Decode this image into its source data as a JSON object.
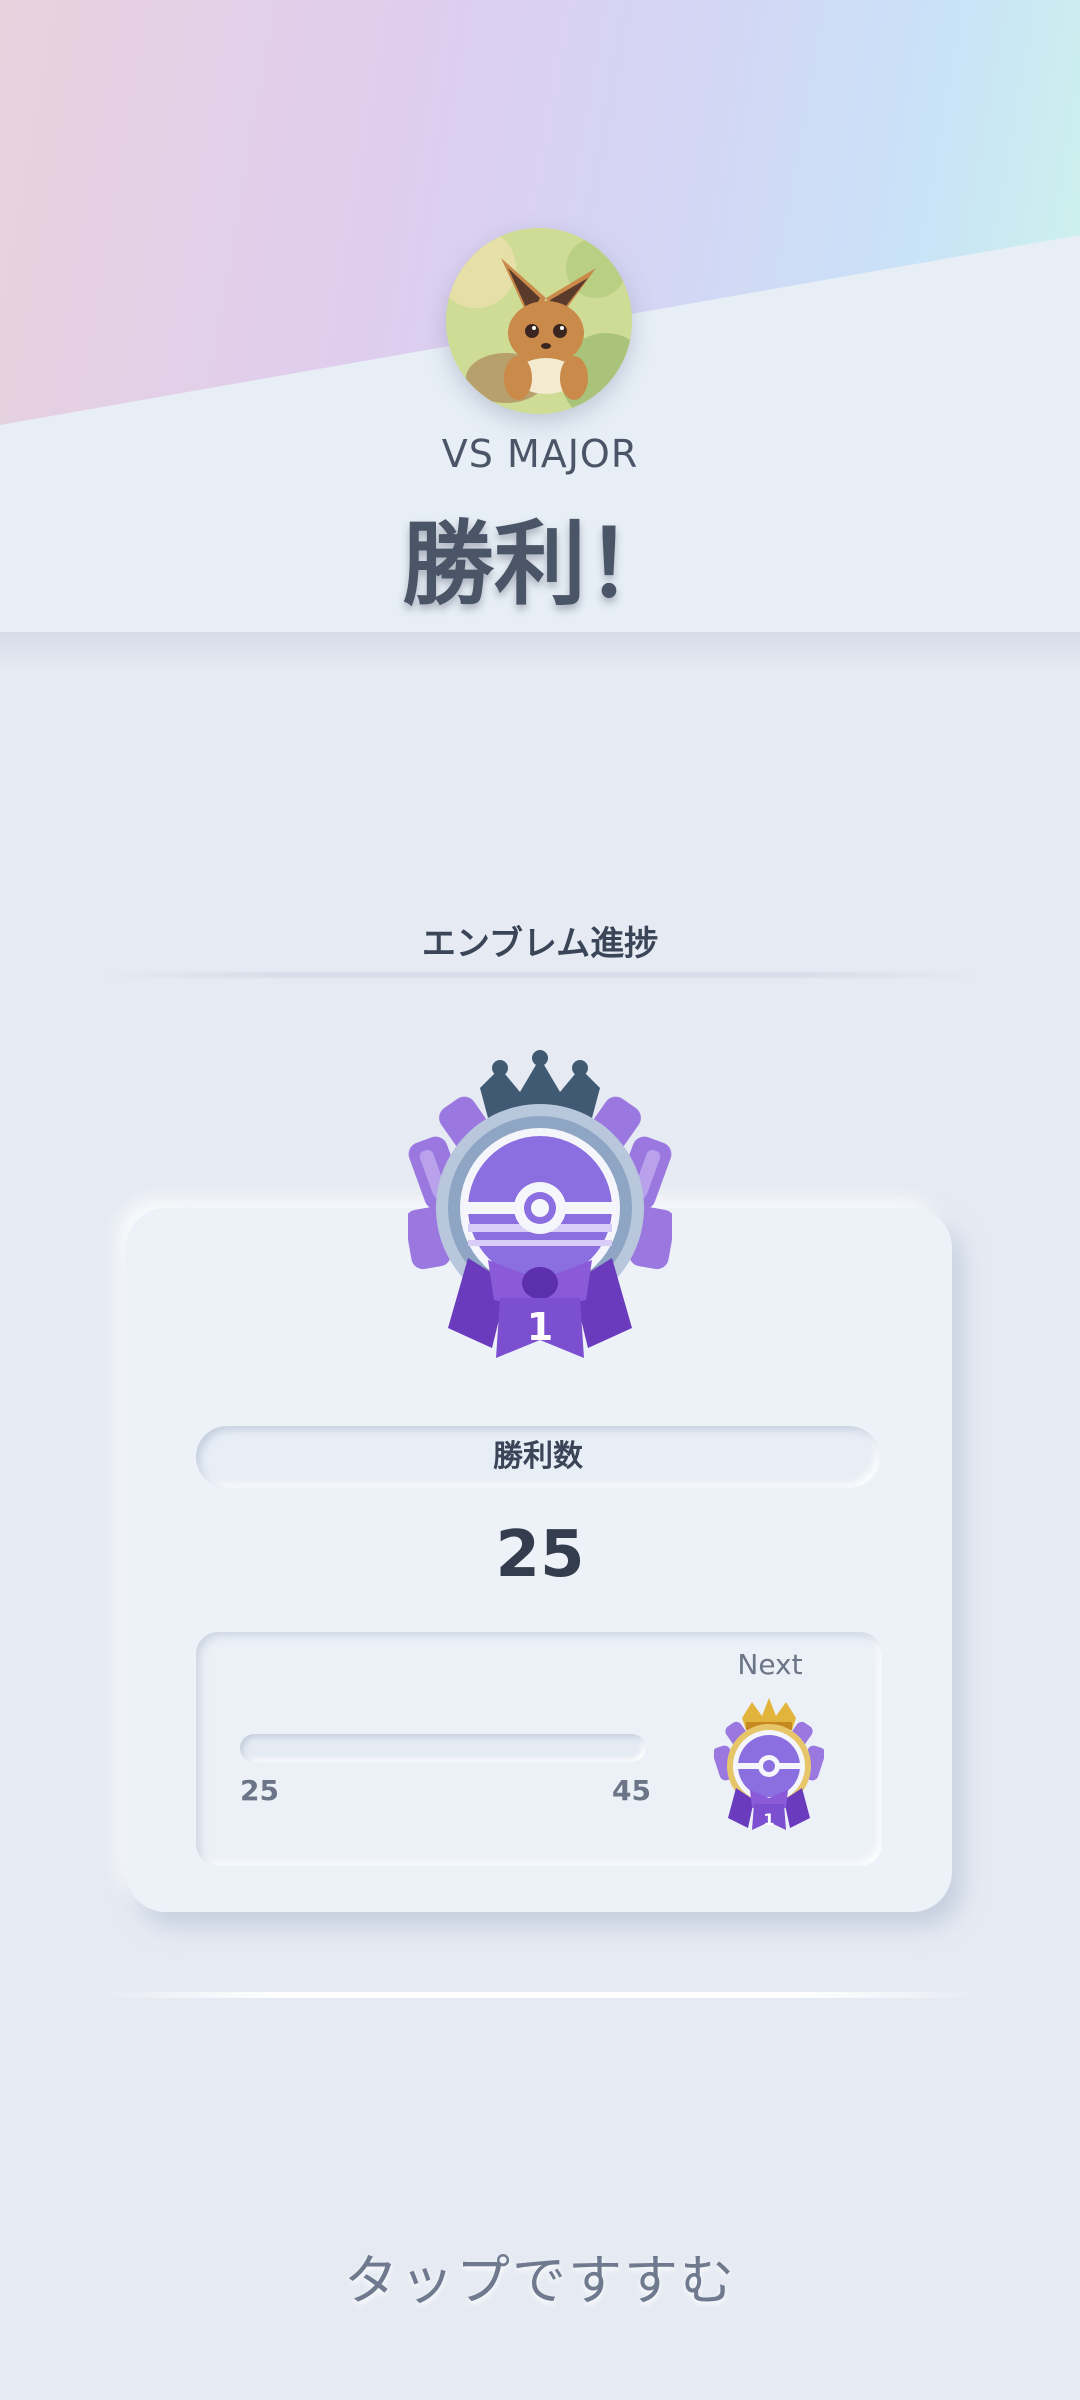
{
  "header": {
    "opponent_label": "VS MAJOR",
    "result_title": "勝利！",
    "avatar_icon": "eevee-avatar-icon"
  },
  "emblem_progress": {
    "section_title": "エンブレム進捗",
    "emblem_icon": "pokeball-ribbon-emblem-icon",
    "emblem_rank": "1",
    "stat_label": "勝利数",
    "stat_value": "25",
    "next_label": "Next",
    "next_emblem_icon": "gold-crown-emblem-icon",
    "next_emblem_rank": "1",
    "range_min": "25",
    "range_max": "45",
    "progress_fraction": 0.0
  },
  "footer": {
    "tap_label": "タップですすむ"
  },
  "colors": {
    "emblem_purple": "#7b4fd0",
    "emblem_crown": "#3f5a72",
    "next_crown_gold": "#e3b43b",
    "text_primary": "#3a4558"
  }
}
